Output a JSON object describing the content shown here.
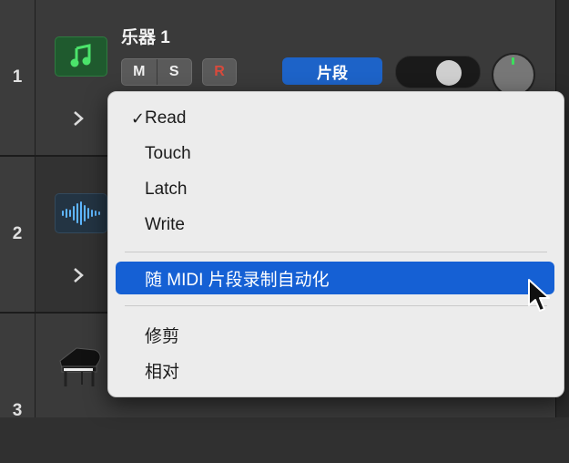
{
  "tracks": [
    {
      "number": "1",
      "name": "乐器 1",
      "mute": "M",
      "solo": "S",
      "record": "R",
      "region_button": "片段",
      "icon": "music-note-icon"
    },
    {
      "number": "2",
      "icon": "waveform-icon"
    },
    {
      "number": "3",
      "icon": "grand-piano-icon"
    }
  ],
  "menu": {
    "items_group1": [
      {
        "label": "Read",
        "checked": true
      },
      {
        "label": "Touch",
        "checked": false
      },
      {
        "label": "Latch",
        "checked": false
      },
      {
        "label": "Write",
        "checked": false
      }
    ],
    "highlighted": "随 MIDI 片段录制自动化",
    "items_group3": [
      "修剪",
      "相对"
    ],
    "check_mark": "✓"
  },
  "colors": {
    "accent": "#1560d4",
    "region_button": "#1d63c8",
    "record_red": "#d94a3c",
    "menu_bg": "#ececec"
  }
}
